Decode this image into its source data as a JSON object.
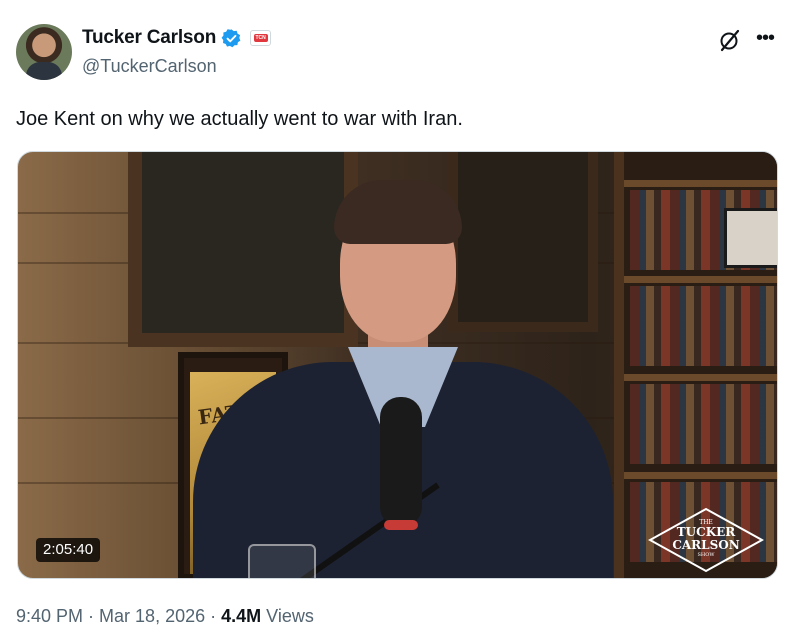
{
  "author": {
    "display_name": "Tucker Carlson",
    "handle": "@TuckerCarlson",
    "verified_icon": "verified-badge-icon",
    "affiliate_badge": "TCN",
    "accent_color": "#1d9bf0"
  },
  "header_actions": {
    "grok_icon": "grok-icon",
    "more_icon": "more-options-icon"
  },
  "tweet": {
    "text": "Joe Kent on why we actually went to war with Iran."
  },
  "video": {
    "duration": "2:05:40",
    "poster_text": "FATI",
    "logo": {
      "the": "THE",
      "line1": "TUCKER",
      "line2": "CARLSON",
      "show": "SHOW"
    }
  },
  "meta": {
    "time": "9:40 PM",
    "sep1": " · ",
    "date": "Mar 18, 2026",
    "sep2": " · ",
    "views_count": "4.4M",
    "views_label": " Views"
  }
}
